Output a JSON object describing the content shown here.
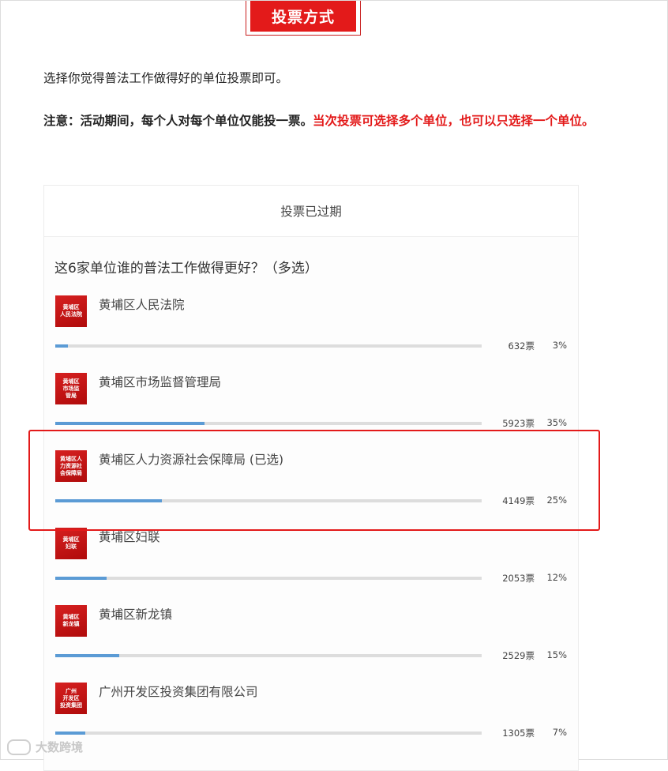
{
  "header": {
    "title": "投票方式"
  },
  "intro": "选择你觉得普法工作做得好的单位投票即可。",
  "note": {
    "black": "注意：活动期间，每个人对每个单位仅能投一票。",
    "red": "当次投票可选择多个单位，也可以只选择一个单位。"
  },
  "poll": {
    "status": "投票已过期",
    "question": "这6家单位谁的普法工作做得更好？（多选）",
    "options": [
      {
        "thumb": "黄埔区\n人民法院",
        "name": "黄埔区人民法院",
        "votes": "632票",
        "pct": "3%",
        "fraction": 0.03
      },
      {
        "thumb": "黄埔区\n市场监\n管局",
        "name": "黄埔区市场监督管理局",
        "votes": "5923票",
        "pct": "35%",
        "fraction": 0.35
      },
      {
        "thumb": "黄埔区人\n力资源社\n会保障局",
        "name": "黄埔区人力资源社会保障局 (已选)",
        "votes": "4149票",
        "pct": "25%",
        "fraction": 0.25
      },
      {
        "thumb": "黄埔区\n妇联",
        "name": "黄埔区妇联",
        "votes": "2053票",
        "pct": "12%",
        "fraction": 0.12
      },
      {
        "thumb": "黄埔区\n新龙镇",
        "name": "黄埔区新龙镇",
        "votes": "2529票",
        "pct": "15%",
        "fraction": 0.15
      },
      {
        "thumb": "广州\n开发区\n投资集团",
        "name": "广州开发区投资集团有限公司",
        "votes": "1305票",
        "pct": "7%",
        "fraction": 0.07
      }
    ]
  },
  "watermark": "大数跨境",
  "colors": {
    "accent": "#e31a1a",
    "bar": "#5b9bd5",
    "track": "#dddddd"
  }
}
